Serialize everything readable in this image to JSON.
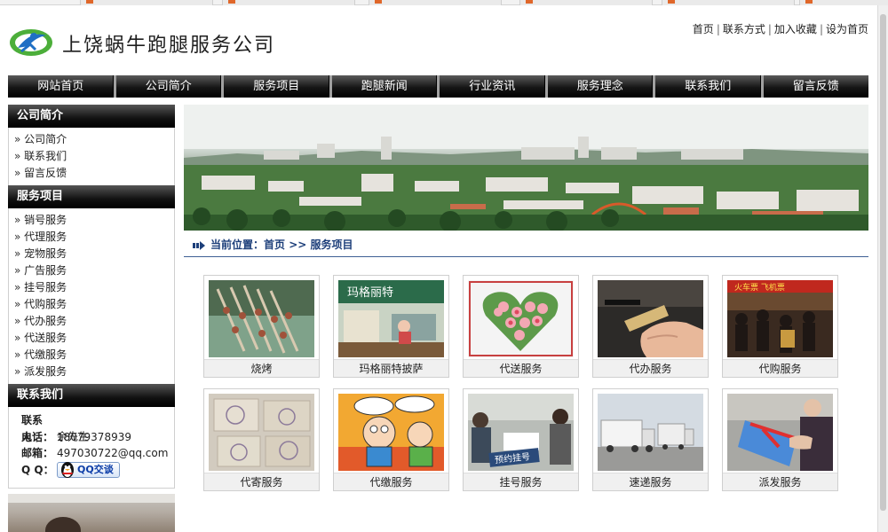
{
  "site": {
    "title": "上饶蜗牛跑腿服务公司",
    "top_links": [
      "首页",
      "联系方式",
      "加入收藏",
      "设为首页"
    ]
  },
  "nav": [
    "网站首页",
    "公司简介",
    "服务项目",
    "跑腿新闻",
    "行业资讯",
    "服务理念",
    "联系我们",
    "留言反馈"
  ],
  "sidebar": {
    "company_title": "公司简介",
    "company_links": [
      "公司简介",
      "联系我们",
      "留言反馈"
    ],
    "services_title": "服务项目",
    "service_links": [
      "销号服务",
      "代理服务",
      "宠物服务",
      "广告服务",
      "挂号服务",
      "代购服务",
      "代办服务",
      "代送服务",
      "代缴服务",
      "派发服务"
    ],
    "contact_title": "联系我们",
    "contact": {
      "person_label": "联系人：",
      "person": "余先生",
      "phone_label": "电话：",
      "phone": "18079378939",
      "email_label": "邮箱：",
      "email": "497030722@qq.com",
      "qq_label": "Q Q：",
      "qq_button": "QQ交谈"
    }
  },
  "breadcrumb": {
    "label": "当前位置：",
    "home": "首页",
    "sep": " >> ",
    "current": "服务项目"
  },
  "products": [
    {
      "name": "烧烤"
    },
    {
      "name": "玛格丽特披萨"
    },
    {
      "name": "代送服务"
    },
    {
      "name": "代办服务"
    },
    {
      "name": "代购服务"
    },
    {
      "name": "代寄服务"
    },
    {
      "name": "代缴服务"
    },
    {
      "name": "挂号服务"
    },
    {
      "name": "速递服务"
    },
    {
      "name": "派发服务"
    }
  ],
  "thumb_text": {
    "pizza_sign": "玛格丽特",
    "hospital_sign": "预约挂号",
    "market_sign": "火车票 飞机票"
  },
  "colors": {
    "nav_bg": "#000000",
    "link_blue": "#1d3f7a",
    "logo_green": "#4cae3a",
    "logo_blue": "#1f6fc4"
  }
}
